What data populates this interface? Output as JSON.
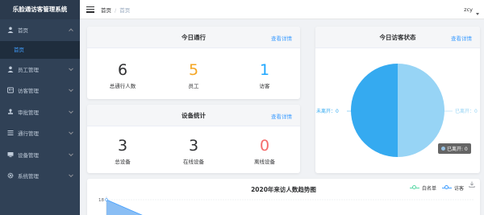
{
  "app": {
    "title": "乐脸通访客管理系统"
  },
  "sidebar": {
    "items": [
      {
        "label": "首页",
        "icon": "user-icon",
        "open": true
      },
      {
        "label": "员工管理",
        "icon": "user-icon"
      },
      {
        "label": "访客管理",
        "icon": "id-card-icon"
      },
      {
        "label": "审批管理",
        "icon": "stamp-icon"
      },
      {
        "label": "通行管理",
        "icon": "list-icon"
      },
      {
        "label": "设备管理",
        "icon": "monitor-icon"
      },
      {
        "label": "系统管理",
        "icon": "gear-icon"
      }
    ],
    "submenu": [
      {
        "label": "首页"
      }
    ]
  },
  "header": {
    "breadcrumb": [
      "首页",
      "首页"
    ],
    "user": "zcy"
  },
  "today_pass": {
    "title": "今日通行",
    "link": "查看详情",
    "stats": [
      {
        "value": "6",
        "label": "总通行人数",
        "color": "#303133"
      },
      {
        "value": "5",
        "label": "员工",
        "color": "#f5a623"
      },
      {
        "value": "1",
        "label": "访客",
        "color": "#1ea7ff"
      }
    ]
  },
  "devices": {
    "title": "设备统计",
    "link": "查看详情",
    "stats": [
      {
        "value": "3",
        "label": "总设备",
        "color": "#303133"
      },
      {
        "value": "3",
        "label": "在线设备",
        "color": "#303133"
      },
      {
        "value": "0",
        "label": "离线设备",
        "color": "#f56c6c"
      }
    ]
  },
  "visitor_status": {
    "title": "今日访客状态",
    "link": "查看详情",
    "left_label": "未离开：0",
    "right_label": "已离开：0",
    "tooltip": "已离开: 0",
    "colors": {
      "left": "#35aaf0",
      "right": "#97d4f5"
    }
  },
  "trend": {
    "title": "2020年来访人数趋势图",
    "legend": [
      "白名单",
      "访客"
    ],
    "ytick": "18"
  },
  "chart_data": {
    "type": "pie",
    "title": "今日访客状态",
    "slices": [
      {
        "name": "未离开",
        "value": 0
      },
      {
        "name": "已离开",
        "value": 0
      }
    ]
  }
}
